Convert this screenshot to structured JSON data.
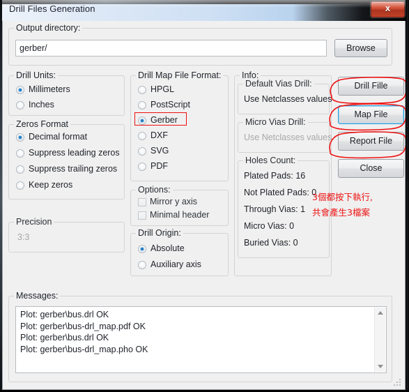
{
  "window": {
    "title": "Drill Files Generation",
    "close_label": "x",
    "close_icon": "close-icon"
  },
  "output_directory": {
    "legend": "Output directory:",
    "value": "gerber/",
    "placeholder": "",
    "browse_label": "Browse"
  },
  "drill_units": {
    "legend": "Drill Units:",
    "options": [
      {
        "label": "Millimeters",
        "checked": true
      },
      {
        "label": "Inches",
        "checked": false
      }
    ]
  },
  "zeros_format": {
    "legend": "Zeros Format",
    "options": [
      {
        "label": "Decimal format",
        "checked": true
      },
      {
        "label": "Suppress leading zeros",
        "checked": false
      },
      {
        "label": "Suppress trailing zeros",
        "checked": false
      },
      {
        "label": "Keep zeros",
        "checked": false
      }
    ]
  },
  "precision": {
    "legend": "Precision",
    "value": "3:3",
    "disabled": true
  },
  "drill_map_format": {
    "legend": "Drill Map File Format:",
    "options": [
      {
        "label": "HPGL",
        "checked": false
      },
      {
        "label": "PostScript",
        "checked": false
      },
      {
        "label": "Gerber",
        "checked": true
      },
      {
        "label": "DXF",
        "checked": false
      },
      {
        "label": "SVG",
        "checked": false
      },
      {
        "label": "PDF",
        "checked": false
      }
    ]
  },
  "options": {
    "legend": "Options:",
    "items": [
      {
        "label": "Mirror y axis",
        "checked": false
      },
      {
        "label": "Minimal header",
        "checked": false
      }
    ]
  },
  "drill_origin": {
    "legend": "Drill Origin:",
    "options": [
      {
        "label": "Absolute",
        "checked": true
      },
      {
        "label": "Auxiliary axis",
        "checked": false
      }
    ]
  },
  "info": {
    "legend": "Info:",
    "default_vias_drill": {
      "legend": "Default Vias Drill:",
      "value": "Use Netclasses values",
      "disabled": false
    },
    "micro_vias_drill": {
      "legend": "Micro Vias Drill:",
      "value": "Use Netclasses values",
      "disabled": true
    },
    "holes_count": {
      "legend": "Holes Count:",
      "rows": [
        "Plated Pads: 16",
        "Not Plated Pads: 0",
        "Through Vias: 1",
        "Micro Vias: 0",
        "Buried Vias: 0"
      ]
    }
  },
  "action_buttons": [
    {
      "label": "Drill Fille",
      "focused": false,
      "annotated": true
    },
    {
      "label": "Map File",
      "focused": true,
      "annotated": true
    },
    {
      "label": "Report File",
      "focused": false,
      "annotated": true
    },
    {
      "label": "Close",
      "focused": false,
      "annotated": false
    }
  ],
  "messages": {
    "legend": "Messages:",
    "lines": [
      "Plot: gerber\\bus.drl OK",
      "Plot: gerber\\bus-drl_map.pdf OK",
      "Plot: gerber\\bus.drl OK",
      "Plot: gerber\\bus-drl_map.pho OK"
    ],
    "text": "Plot: gerber\\bus.drl OK\nPlot: gerber\\bus-drl_map.pdf OK\nPlot: gerber\\bus.drl OK\nPlot: gerber\\bus-drl_map.pho OK"
  },
  "annotations": {
    "color": "#ee1111",
    "note_line1": "3個都按下執行,",
    "note_line2": "共會產生3檔案"
  }
}
